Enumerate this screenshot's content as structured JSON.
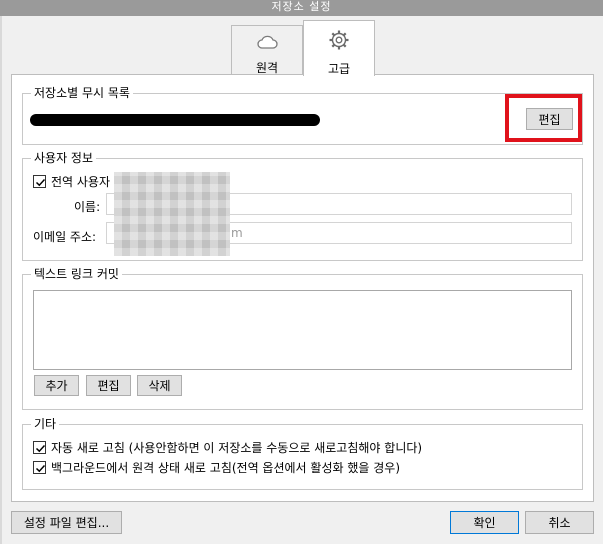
{
  "window": {
    "title": "저장소 설정"
  },
  "tabs": [
    {
      "label": "원격",
      "icon": "cloud-icon"
    },
    {
      "label": "고급",
      "icon": "gear-icon"
    }
  ],
  "ignore_section": {
    "legend": "저장소별 무시 목록",
    "edit_button": "편집"
  },
  "user_section": {
    "legend": "사용자 정보",
    "global_checkbox_label": "전역 사용자",
    "name_label": "이름:",
    "email_label": "이메일 주소:",
    "email_value_fragment": "m"
  },
  "textlink_section": {
    "legend": "텍스트 링크 커밋",
    "add_button": "추가",
    "edit_button": "편집",
    "delete_button": "삭제"
  },
  "misc_section": {
    "legend": "기타",
    "auto_refresh_label": "자동 새로 고침 (사용안함하면 이 저장소를 수동으로 새로고침해야 합니다)",
    "bg_refresh_label": "백그라운드에서 원격 상태 새로 고침(전역 옵션에서 활성화 했을 경우)"
  },
  "footer": {
    "edit_config_button": "설정 파일 편집...",
    "ok_button": "확인",
    "cancel_button": "취소"
  },
  "colors": {
    "highlight": "#e0121b"
  }
}
